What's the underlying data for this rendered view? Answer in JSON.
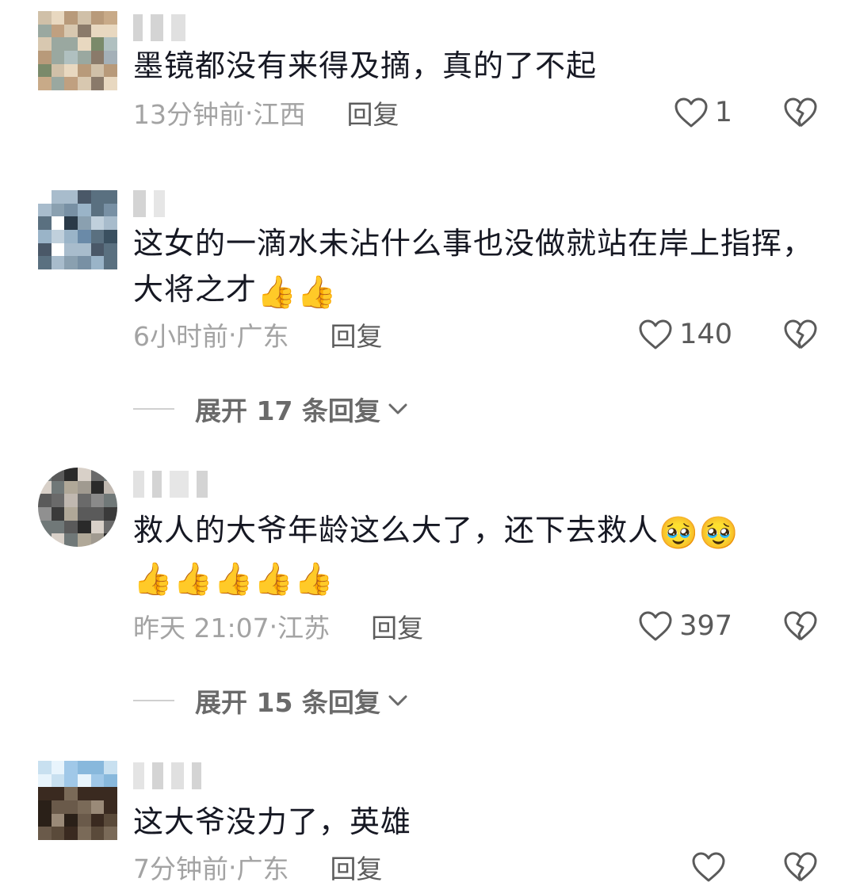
{
  "comments": [
    {
      "text": "墨镜都没有来得及摘，真的了不起",
      "time": "13分钟前",
      "region": "江西",
      "reply_label": "回复",
      "likes": "1",
      "emojis": ""
    },
    {
      "text": "这女的一滴水未沾什么事也没做就站在岸上指挥，大将之才",
      "time": "6小时前",
      "region": "广东",
      "reply_label": "回复",
      "likes": "140",
      "emojis": "👍👍",
      "expand_label": "展开 17 条回复"
    },
    {
      "text": "救人的大爷年龄这么大了，还下去救人",
      "time": "昨天 21:07",
      "region": "江苏",
      "reply_label": "回复",
      "likes": "397",
      "emojis": "🥹🥹",
      "emojis_line2": "👍👍👍👍👍",
      "expand_label": "展开 15 条回复"
    },
    {
      "text": "这大爷没力了，英雄",
      "time": "7分钟前",
      "region": "广东",
      "reply_label": "回复",
      "likes": "",
      "emojis": ""
    }
  ],
  "separator": " · ",
  "icons": {
    "like": "heart-outline-icon",
    "dislike": "broken-heart-icon",
    "expand": "chevron-down-icon"
  },
  "colors": {
    "text": "#161823",
    "meta": "#a3a3a3",
    "reply": "#5c5c5c",
    "expand": "#6a6a6a"
  }
}
